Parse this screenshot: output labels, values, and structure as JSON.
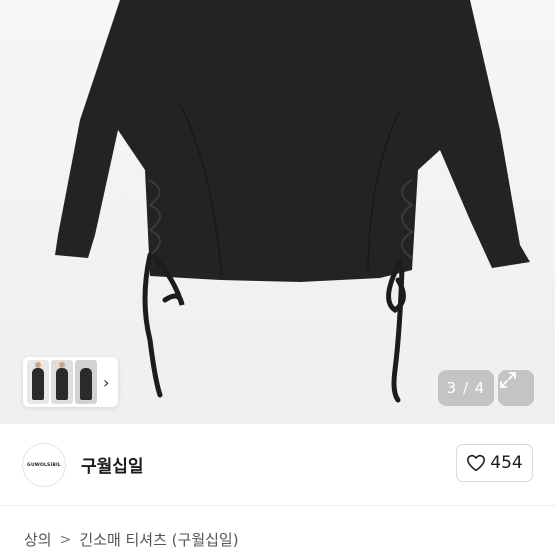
{
  "gallery": {
    "counter": "3 / 4",
    "thumb_next_icon": "chevron-right-icon",
    "expand_icon": "expand-icon"
  },
  "seller": {
    "avatar_text": "GUWOLSIBIL",
    "name": "구월십일"
  },
  "likes": {
    "icon": "heart-icon",
    "count": "454"
  },
  "breadcrumb": {
    "level1": "상의",
    "separator": ">",
    "level2": "긴소매 티셔츠 (구월십일)"
  },
  "colors": {
    "garment": "#232323",
    "background": "#f2f2f2",
    "overlay": "#a0a0a0"
  }
}
